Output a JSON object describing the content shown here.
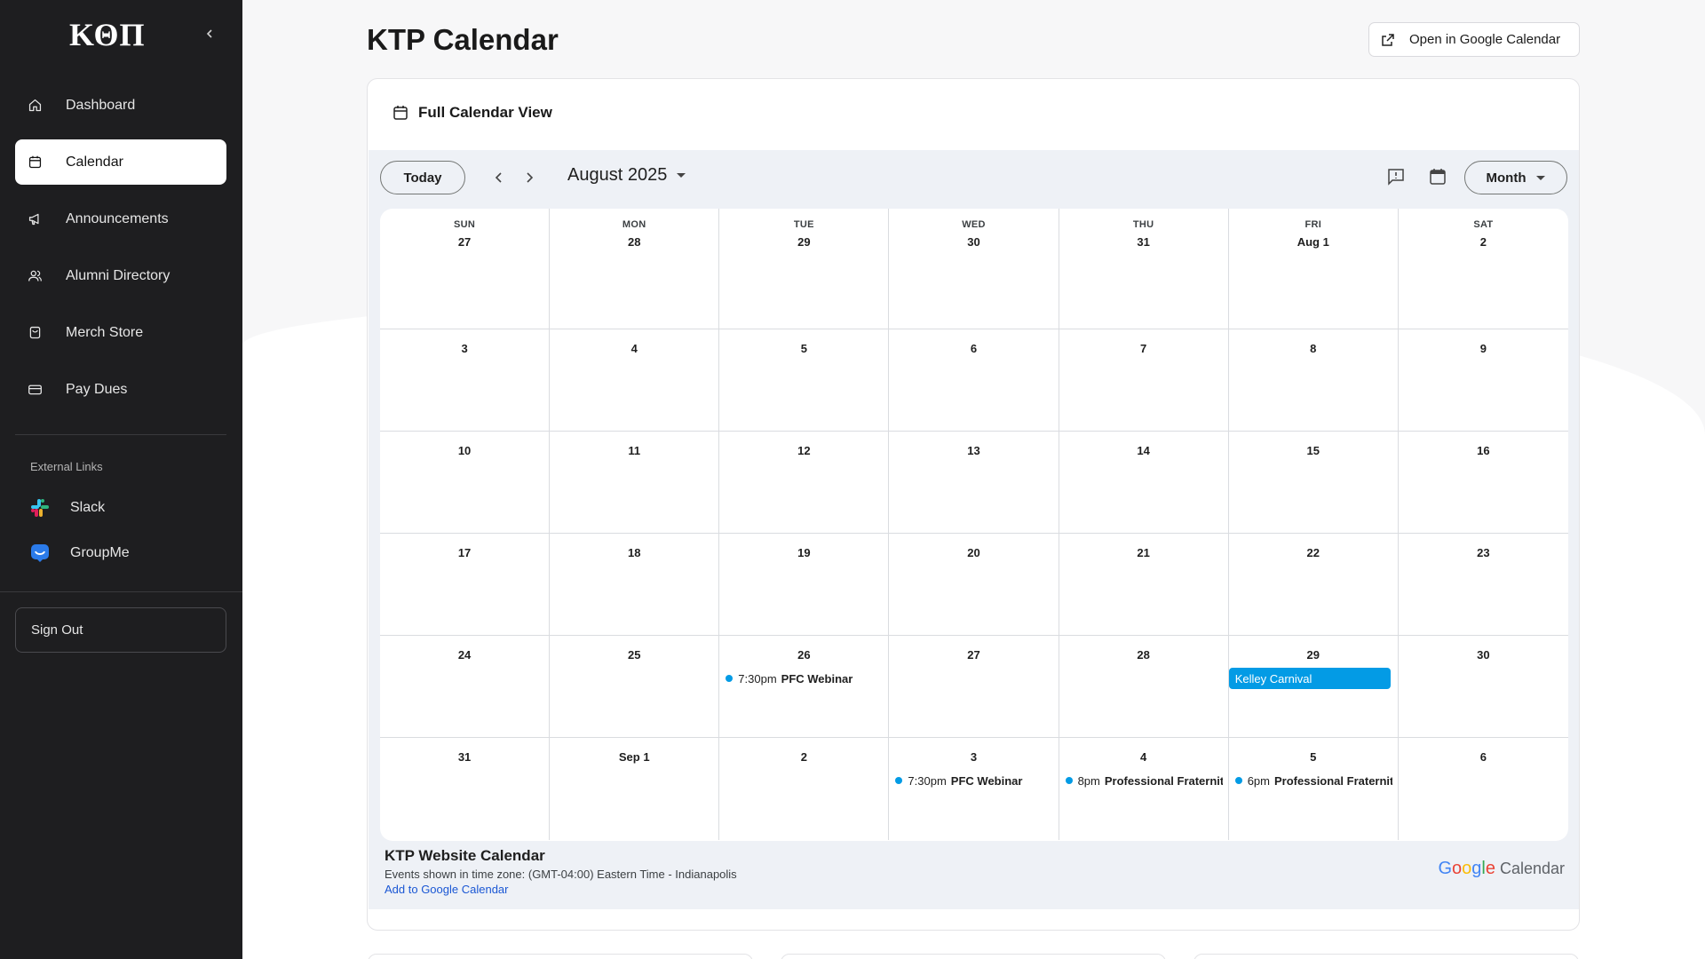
{
  "sidebar": {
    "logo": "ΚΘΠ",
    "collapse_icon": "chevron-left-icon",
    "items": [
      {
        "label": "Dashboard",
        "icon": "home-icon"
      },
      {
        "label": "Calendar",
        "icon": "calendar-icon"
      },
      {
        "label": "Announcements",
        "icon": "megaphone-icon"
      },
      {
        "label": "Alumni Directory",
        "icon": "users-icon"
      },
      {
        "label": "Merch Store",
        "icon": "shopping-bag-icon"
      },
      {
        "label": "Pay Dues",
        "icon": "credit-card-icon"
      }
    ],
    "external_title": "External Links",
    "external": [
      {
        "label": "Slack",
        "icon": "slack-icon"
      },
      {
        "label": "GroupMe",
        "icon": "groupme-icon"
      }
    ],
    "signout_label": "Sign Out"
  },
  "header": {
    "title": "KTP Calendar",
    "gcal_button": "Open in Google Calendar"
  },
  "card": {
    "title": "Full Calendar View"
  },
  "calendar": {
    "today_label": "Today",
    "month_label": "August 2025",
    "view_label": "Month",
    "weekdays": [
      "SUN",
      "MON",
      "TUE",
      "WED",
      "THU",
      "FRI",
      "SAT"
    ],
    "weeks": [
      [
        "27",
        "28",
        "29",
        "30",
        "31",
        "Aug 1",
        "2"
      ],
      [
        "3",
        "4",
        "5",
        "6",
        "7",
        "8",
        "9"
      ],
      [
        "10",
        "11",
        "12",
        "13",
        "14",
        "15",
        "16"
      ],
      [
        "17",
        "18",
        "19",
        "20",
        "21",
        "22",
        "23"
      ],
      [
        "24",
        "25",
        "26",
        "27",
        "28",
        "29",
        "30"
      ],
      [
        "31",
        "Sep 1",
        "2",
        "3",
        "4",
        "5",
        "6"
      ]
    ],
    "events": [
      {
        "week": 4,
        "day": 2,
        "time": "7:30pm",
        "name": "PFC Webinar",
        "allday": false
      },
      {
        "week": 4,
        "day": 5,
        "time": "",
        "name": "Kelley Carnival",
        "allday": true
      },
      {
        "week": 5,
        "day": 3,
        "time": "7:30pm",
        "name": "PFC Webinar",
        "allday": false
      },
      {
        "week": 5,
        "day": 4,
        "time": "8pm",
        "name": "Professional Fraternit",
        "allday": false
      },
      {
        "week": 5,
        "day": 5,
        "time": "6pm",
        "name": "Professional Fraternit",
        "allday": false
      }
    ],
    "event_color": "#039be5"
  },
  "footer": {
    "title": "KTP Website Calendar",
    "timezone": "Events shown in time zone: (GMT-04:00) Eastern Time - Indianapolis",
    "add_link": "Add to Google Calendar",
    "brand_google": "Google",
    "brand_calendar": "Calendar"
  }
}
